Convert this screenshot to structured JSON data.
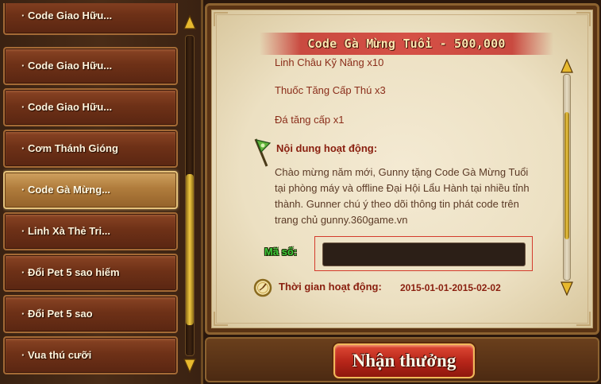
{
  "event_list": {
    "items": [
      {
        "label": "· Code Giao Hữu...",
        "selected": false
      },
      {
        "label": "· Code Giao Hữu...",
        "selected": false
      },
      {
        "label": "· Code Giao Hữu...",
        "selected": false
      },
      {
        "label": "· Cơm Thánh Gióng",
        "selected": false
      },
      {
        "label": "· Code Gà Mừng...",
        "selected": true
      },
      {
        "label": "· Linh Xà Thẻ Tri...",
        "selected": false
      },
      {
        "label": "· Đổi Pet 5 sao hiếm",
        "selected": false
      },
      {
        "label": "· Đổi Pet 5 sao",
        "selected": false
      },
      {
        "label": "· Vua thú cưỡi",
        "selected": false
      }
    ],
    "scroll_position": 0.82
  },
  "detail": {
    "title": "Code Gà Mừng Tuổi - 500,000",
    "rewards": [
      "Linh Châu Kỹ Năng x10",
      "Thuốc Tăng Cấp Thú x3",
      "Đá tăng cấp x1"
    ],
    "content_heading": "Nội dung hoạt động:",
    "content_text": "Chào mừng năm mới, Gunny tặng Code Gà Mừng Tuổi tại phòng máy và offline Đại Hội Lẩu Hành tại nhiều tỉnh thành. Gunner chú ý theo dõi thông tin phát code trên trang chủ gunny.360game.vn",
    "code_label": "Mã số:",
    "code_value": "",
    "time_label": "Thời gian hoạt động:",
    "time_value": "2015-01-01-2015-02-02",
    "scroll_position": 0.48
  },
  "claim_button_label": "Nhận thưởng",
  "icons": {
    "content": "flag-icon",
    "time": "compass-clock-icon",
    "scroll_up": "arrow-up-icon",
    "scroll_down": "arrow-down-icon"
  },
  "colors": {
    "item_bg": "#6e3117",
    "item_selected_bg": "#b07c3c",
    "title_ribbon": "#d55046",
    "heading_red": "#8a2010",
    "code_label_green": "#3ec93a",
    "button_red": "#b8261a"
  }
}
